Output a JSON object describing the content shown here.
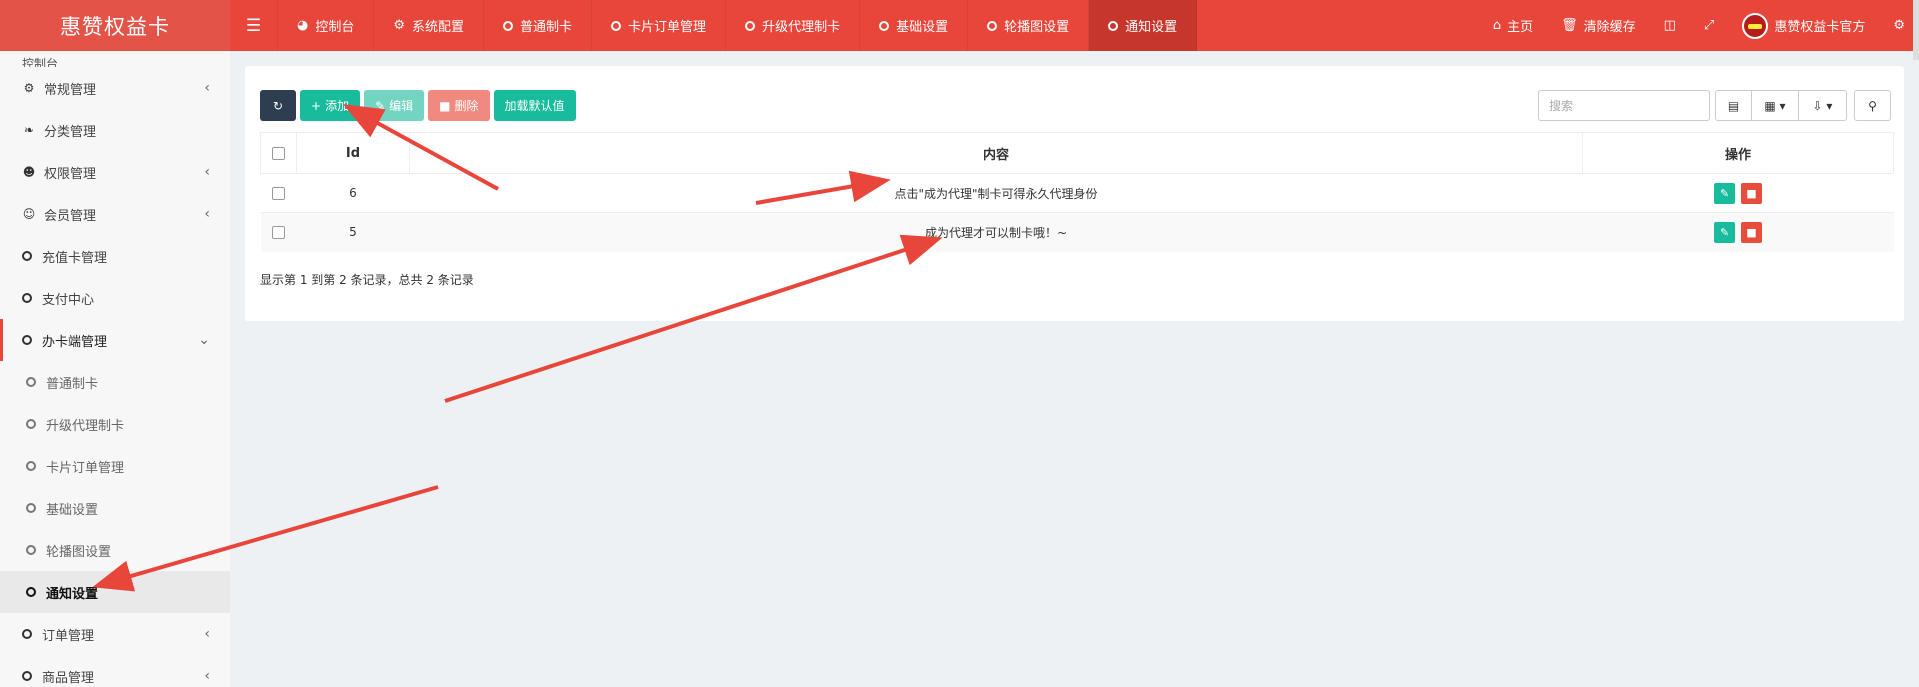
{
  "app": {
    "brand": "惠赞权益卡"
  },
  "top_tabs": [
    {
      "label": "控制台",
      "icon": "dashboard-icon"
    },
    {
      "label": "系统配置",
      "icon": "gear-icon"
    },
    {
      "label": "普通制卡",
      "icon": "circle-icon"
    },
    {
      "label": "卡片订单管理",
      "icon": "circle-icon"
    },
    {
      "label": "升级代理制卡",
      "icon": "circle-icon"
    },
    {
      "label": "基础设置",
      "icon": "circle-icon"
    },
    {
      "label": "轮播图设置",
      "icon": "circle-icon"
    },
    {
      "label": "通知设置",
      "icon": "circle-icon",
      "active": true
    }
  ],
  "top_right": {
    "home": "主页",
    "clear_cache": "清除缓存",
    "user": "惠赞权益卡官方"
  },
  "sidebar": {
    "top_partial": "控制台",
    "items": [
      {
        "label": "常规管理",
        "icon": "gears-icon",
        "caret": "‹"
      },
      {
        "label": "分类管理",
        "icon": "leaf-icon"
      },
      {
        "label": "权限管理",
        "icon": "group-icon",
        "caret": "‹"
      },
      {
        "label": "会员管理",
        "icon": "user-circle-icon",
        "caret": "‹"
      },
      {
        "label": "充值卡管理",
        "icon": "circle-icon"
      },
      {
        "label": "支付中心",
        "icon": "circle-icon"
      },
      {
        "label": "办卡端管理",
        "icon": "circle-icon",
        "caret": "⌄",
        "open": true
      },
      {
        "label": "普通制卡",
        "sub": true
      },
      {
        "label": "升级代理制卡",
        "sub": true
      },
      {
        "label": "卡片订单管理",
        "sub": true
      },
      {
        "label": "基础设置",
        "sub": true
      },
      {
        "label": "轮播图设置",
        "sub": true
      },
      {
        "label": "通知设置",
        "sub": true,
        "active": true
      },
      {
        "label": "订单管理",
        "icon": "circle-icon",
        "caret": "‹"
      },
      {
        "label": "商品管理",
        "icon": "circle-icon",
        "caret": "‹"
      }
    ]
  },
  "toolbar": {
    "add": "添加",
    "edit": "编辑",
    "delete": "删除",
    "load_default": "加载默认值",
    "search_placeholder": "搜索"
  },
  "table": {
    "headers": {
      "id": "Id",
      "content": "内容",
      "ops": "操作"
    },
    "rows": [
      {
        "id": "6",
        "content": "点击\"成为代理\"制卡可得永久代理身份"
      },
      {
        "id": "5",
        "content": "成为代理才可以制卡哦！~"
      }
    ]
  },
  "pager": "显示第 1 到第 2 条记录，总共 2 条记录",
  "colors": {
    "primary": "#e8463a",
    "success": "#18bc9c",
    "danger": "#e74c3c",
    "dark": "#2c3e50"
  }
}
